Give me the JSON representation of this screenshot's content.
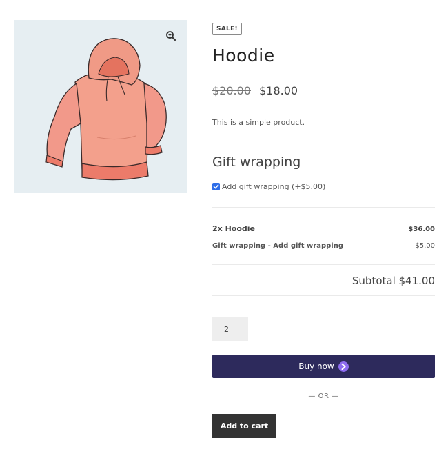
{
  "product": {
    "badge": "SALE!",
    "title": "Hoodie",
    "old_price": "$20.00",
    "new_price": "$18.00",
    "description": "This is a simple product.",
    "zoom_icon": "magnifier-plus-icon"
  },
  "gift": {
    "heading": "Gift wrapping",
    "option_label": "Add gift wrapping (+$5.00)",
    "checked": true
  },
  "order_summary": {
    "item": {
      "label": "2x Hoodie",
      "amount": "$36.00"
    },
    "addon": {
      "label": "Gift wrapping - Add gift wrapping",
      "amount": "$5.00"
    },
    "subtotal": "Subtotal $41.00"
  },
  "quantity": "2",
  "buttons": {
    "buy_now": "Buy now",
    "or_separator": "— OR —",
    "add_to_cart": "Add to cart"
  },
  "colors": {
    "buy_now_bg": "#2d2a5c",
    "add_to_cart_bg": "#333333",
    "checkbox": "#2f6ee8",
    "image_bg": "#e6eef2",
    "hoodie": "#f0907a"
  }
}
